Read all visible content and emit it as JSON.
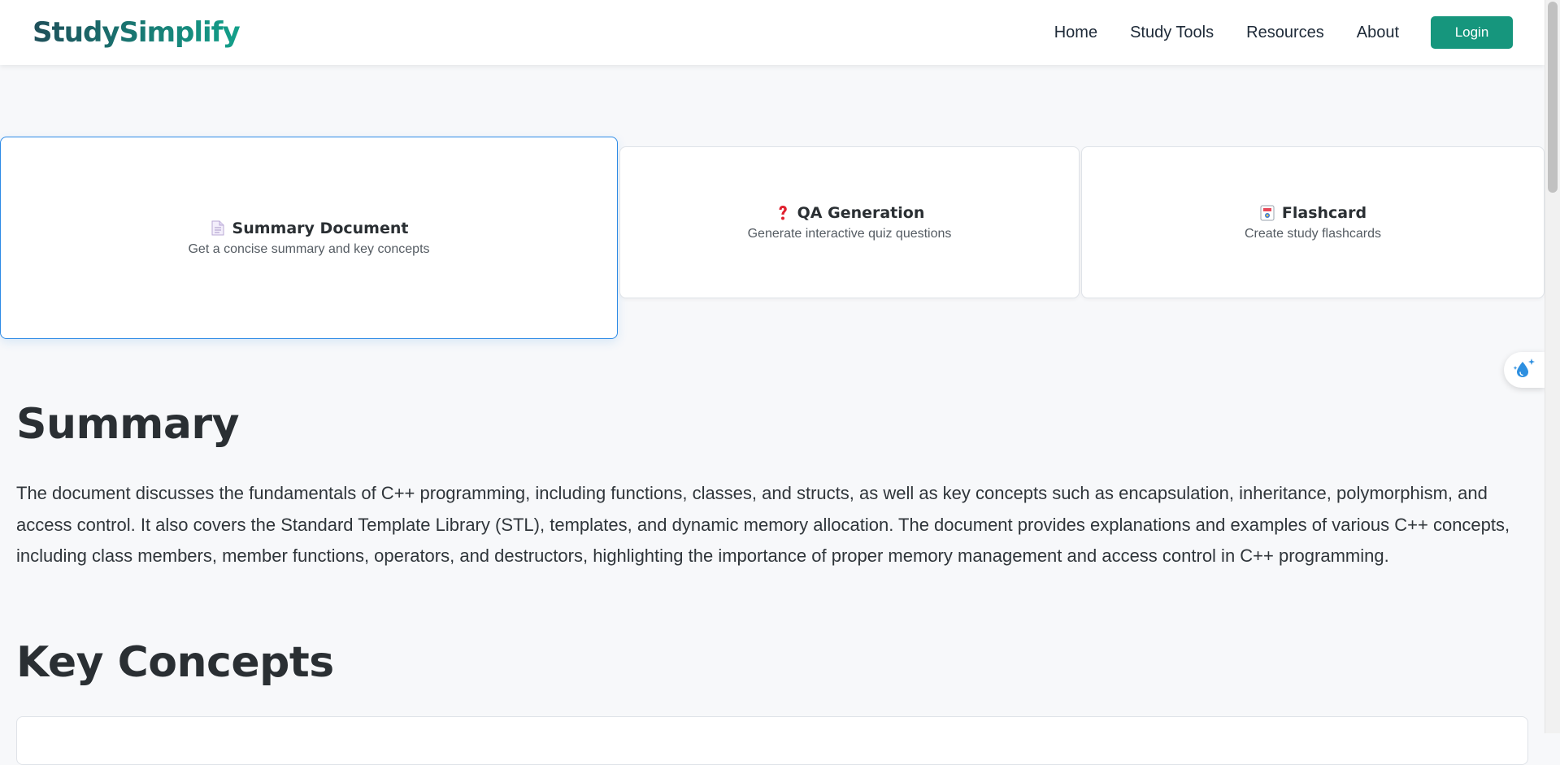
{
  "header": {
    "logo": "StudySimplify",
    "nav": {
      "home": "Home",
      "study_tools": "Study Tools",
      "resources": "Resources",
      "about": "About"
    },
    "login_label": "Login"
  },
  "tools": [
    {
      "icon": "document-icon",
      "title": "Summary Document",
      "description": "Get a concise summary and key concepts",
      "active": true
    },
    {
      "icon": "question-mark-icon",
      "title": "QA Generation",
      "description": "Generate interactive quiz questions",
      "active": false
    },
    {
      "icon": "flashcard-icon",
      "title": "Flashcard",
      "description": "Create study flashcards",
      "active": false
    }
  ],
  "summary": {
    "heading": "Summary",
    "text": "The document discusses the fundamentals of C++ programming, including functions, classes, and structs, as well as key concepts such as encapsulation, inheritance, polymorphism, and access control. It also covers the Standard Template Library (STL), templates, and dynamic memory allocation. The document provides explanations and examples of various C++ concepts, including class members, member functions, operators, and destructors, highlighting the importance of proper memory management and access control in C++ programming."
  },
  "key_concepts": {
    "heading": "Key Concepts"
  },
  "colors": {
    "accent": "#16967d",
    "active_border": "#2e8be6",
    "background": "#f7f8fa",
    "text": "#2a2f33"
  }
}
